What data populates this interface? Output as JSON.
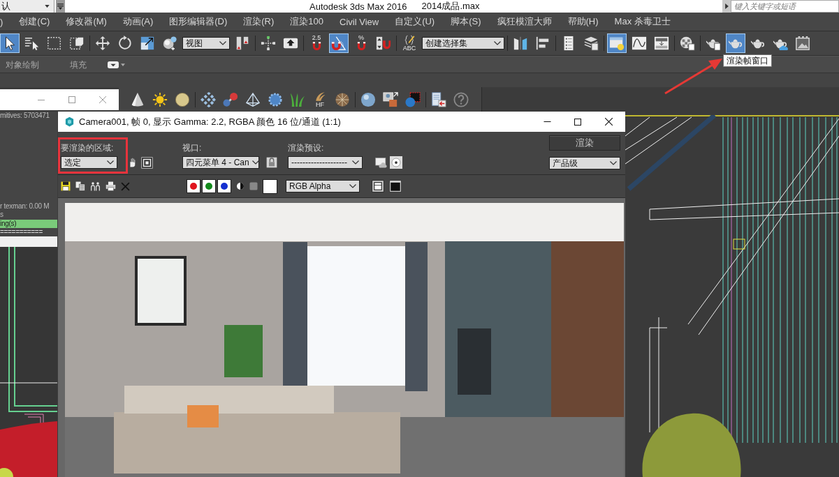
{
  "title_bar": {
    "workspace": "认",
    "app_title": "Autodesk 3ds Max 2016",
    "file_name": "2014成品.max",
    "search": {
      "placeholder": "键入关键字或短语"
    }
  },
  "menu_bar": [
    ")",
    "创建(C)",
    "修改器(M)",
    "动画(A)",
    "图形编辑器(D)",
    "渲染(R)",
    "渲染100",
    "Civil View",
    "自定义(U)",
    "脚本(S)",
    "疯狂模渲大师",
    "帮助(H)",
    "Max 杀毒卫士"
  ],
  "main_toolbar": [
    [
      {
        "kind": "button",
        "selected": true
      },
      {
        "kind": "button",
        "selected": false
      },
      {
        "kind": "button",
        "selected": false
      },
      {
        "kind": "button",
        "selected": false
      }
    ],
    [
      {
        "kind": "button",
        "selected": false
      },
      {
        "kind": "button",
        "selected": false
      },
      {
        "kind": "button",
        "selected": false
      },
      {
        "kind": "button",
        "selected": false
      },
      {
        "kind": "dropdown",
        "value": "视图"
      },
      {
        "kind": "button",
        "selected": false
      }
    ],
    [
      {
        "kind": "button",
        "selected": false
      },
      {
        "kind": "button",
        "selected": false
      }
    ],
    [
      {
        "kind": "button",
        "selected": false,
        "label": "2.5"
      },
      {
        "kind": "button",
        "selected": true
      },
      {
        "kind": "button",
        "selected": false,
        "label": "%"
      },
      {
        "kind": "button",
        "selected": false
      }
    ],
    [
      {
        "kind": "button",
        "selected": false,
        "label": "ABC"
      },
      {
        "kind": "dropdown",
        "value": "创建选择集"
      }
    ],
    [
      {
        "kind": "button",
        "selected": false
      },
      {
        "kind": "button",
        "selected": false
      }
    ],
    [
      {
        "kind": "button",
        "selected": false
      },
      {
        "kind": "button",
        "selected": false
      }
    ],
    [
      {
        "kind": "button",
        "selected": true
      },
      {
        "kind": "button",
        "selected": false
      },
      {
        "kind": "button",
        "selected": false
      }
    ],
    [
      {
        "kind": "button",
        "selected": false
      }
    ],
    [
      {
        "kind": "button",
        "selected": false
      },
      {
        "kind": "button",
        "selected": true
      },
      {
        "kind": "button",
        "selected": false
      },
      {
        "kind": "button",
        "selected": false
      },
      {
        "kind": "button",
        "selected": false
      }
    ]
  ],
  "tooltip": "渲染帧窗口",
  "ribbon_tabs": [
    {
      "label": "对象绘制",
      "selected": false
    },
    {
      "label": "填充",
      "selected": false
    }
  ],
  "create_toolbar": [
    [
      {
        "kind": "button",
        "selected": false
      },
      {
        "kind": "button",
        "selected": false
      },
      {
        "kind": "button",
        "selected": false
      }
    ],
    [
      {
        "kind": "button",
        "selected": false
      },
      {
        "kind": "button",
        "selected": false
      },
      {
        "kind": "button",
        "selected": false
      },
      {
        "kind": "button",
        "selected": false
      },
      {
        "kind": "button",
        "selected": false
      },
      {
        "kind": "button",
        "selected": false,
        "label": "HF"
      },
      {
        "kind": "button",
        "selected": false
      }
    ],
    [
      {
        "kind": "button",
        "selected": false
      },
      {
        "kind": "button",
        "selected": false
      },
      {
        "kind": "button",
        "selected": false
      }
    ],
    [
      {
        "kind": "button",
        "selected": false
      },
      {
        "kind": "button",
        "selected": false
      }
    ]
  ],
  "left_panel": {
    "top_line": "mitives: 5703471",
    "log_lines": [
      "r texman: 0.00 M",
      "s"
    ],
    "highlight_line": "ing(s)",
    "rule_line": "==========="
  },
  "render_window": {
    "title": "Camera001, 帧 0, 显示 Gamma: 2.2, RGBA 颜色 16 位/通道 (1:1)",
    "area": {
      "label": "要渲染的区域:",
      "value": "选定",
      "highlighted": true
    },
    "viewport": {
      "label": "视口:",
      "value": "四元菜单 4 - Can"
    },
    "preset": {
      "label": "渲染预设:",
      "value": "--------------------"
    },
    "render_button": "渲染",
    "quality": "产品级",
    "channels": [
      {
        "color": "#e0151f",
        "on": true
      },
      {
        "color": "#138a1c",
        "on": true
      },
      {
        "color": "#1530d0",
        "on": true
      }
    ],
    "swatch": {
      "color": "#ffffff"
    },
    "display": "RGB Alpha"
  }
}
